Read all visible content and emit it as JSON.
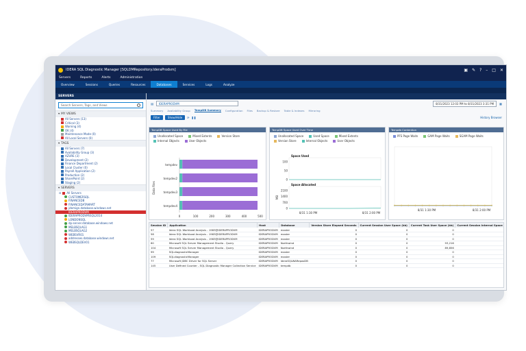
{
  "window": {
    "title": "IDERA SQL Diagnostic Manager [SQLDMRepository.IderaProdsm]"
  },
  "menu": [
    "Servers",
    "Reports",
    "Alerts",
    "Administration"
  ],
  "nav": [
    "Overview",
    "Sessions",
    "Queries",
    "Resources",
    "Databases",
    "Services",
    "Logs",
    "Analyze"
  ],
  "left": {
    "header": "SERVERS",
    "search_placeholder": "Search Servers, Tags, and Views",
    "my_views_label": "MY VIEWS",
    "views": [
      {
        "label": "All Servers (13)",
        "color": "#d32f2f"
      },
      {
        "label": "Critical (3)",
        "color": "#d32f2f"
      },
      {
        "label": "Warning (4)",
        "color": "#f2a900"
      },
      {
        "label": "OK (4)",
        "color": "#43a047"
      },
      {
        "label": "Maintenance Mode (0)",
        "color": "#9e9e9e"
      },
      {
        "label": "All Local Servers (0)",
        "color": "#d32f2f"
      }
    ],
    "tags_label": "TAGS",
    "tags": [
      {
        "label": "All Servers (7)"
      },
      {
        "label": "Availability Group (3)"
      },
      {
        "label": "AZURE (3)"
      },
      {
        "label": "Development (2)"
      },
      {
        "label": "Finance Department (2)"
      },
      {
        "label": "Local Cluster (0)"
      },
      {
        "label": "Payroll Application (2)"
      },
      {
        "label": "Production (2)"
      },
      {
        "label": "SharePoint (2)"
      },
      {
        "label": "Staging (2)"
      }
    ],
    "servers_label": "SERVERS",
    "servers_group": "All Servers",
    "servers": [
      {
        "label": "CUSTOMERSQL",
        "color": "#43a047"
      },
      {
        "label": "FINANCEDB",
        "color": "#f2a900"
      },
      {
        "label": "FINANCEDATAMART",
        "color": "#d32f2f"
      },
      {
        "label": "jdemign.database.windows.net",
        "color": "#d32f2f"
      },
      {
        "label": "IDERAPRODVM",
        "color": "#d32f2f",
        "selected": true
      },
      {
        "label": "IDERAPRODVM\\SQL2014",
        "color": "#43a047"
      },
      {
        "label": "LONDONSQL",
        "color": "#f2a900"
      },
      {
        "label": "dp-server.database.windows.net",
        "color": "#43a047"
      },
      {
        "label": "MELBSQLAG1",
        "color": "#43a047"
      },
      {
        "label": "MELBSQLAG2",
        "color": "#43a047"
      },
      {
        "label": "WEBSVR01",
        "color": "#d32f2f"
      },
      {
        "label": "addresses.database.windows.net",
        "color": "#d32f2f"
      },
      {
        "label": "WEBSQLDEV01",
        "color": "#d32f2f"
      }
    ]
  },
  "main": {
    "filter_value": "IDERAPRODVM",
    "date_range": "8/31/2023 12:03 PM to 8/31/2023 3:31 PM",
    "tabs": [
      "Summary",
      "Availability Group",
      "TempDB Summary",
      "Configuration",
      "Files",
      "Backup & Restore",
      "Table & Indexes",
      "Mirroring"
    ],
    "active_tab": "TempDB Summary",
    "filter_btn": "Filter",
    "show_hide": "Show/Hide",
    "history_link": "History Browser"
  },
  "chart1": {
    "header": "TempDB Space Used By File",
    "legend": [
      {
        "label": "Unallocated Space",
        "color": "#8fa8d6"
      },
      {
        "label": "Mixed Extents",
        "color": "#7cc576"
      },
      {
        "label": "Version Store",
        "color": "#e6b85c"
      },
      {
        "label": "Internal Objects",
        "color": "#54c2b5"
      },
      {
        "label": "User Objects",
        "color": "#9b6dd6"
      }
    ],
    "ylabel": "Data Files",
    "xlabel": "Megabytes",
    "xticks": [
      "0",
      "100",
      "200",
      "300",
      "400",
      "500"
    ]
  },
  "chart2": {
    "header": "TempDB Space Used Over Time",
    "legend": [
      {
        "label": "Unallocated Space",
        "color": "#8fa8d6"
      },
      {
        "label": "Used Space",
        "color": "#54c2b5"
      },
      {
        "label": "Mixed Extents",
        "color": "#7cc576"
      },
      {
        "label": "Version Store",
        "color": "#e6b85c"
      },
      {
        "label": "Internal Objects",
        "color": "#54c2b5"
      },
      {
        "label": "User Objects",
        "color": "#9b6dd6"
      }
    ],
    "sub1": "Space Used",
    "sub1_ticks": [
      "100",
      "50",
      "0"
    ],
    "sub2": "Space Allocated",
    "sub2_ticks": [
      "2100",
      "1400",
      "700",
      "0"
    ],
    "ylabel": "MB",
    "xticks": [
      "8/31 1:30 PM",
      "8/31 2:00 PM"
    ]
  },
  "chart3": {
    "header": "Tempdb Contention",
    "legend": [
      {
        "label": "PFS Page Waits",
        "color": "#7b8fd9"
      },
      {
        "label": "GAM Page Waits",
        "color": "#7cc576"
      },
      {
        "label": "SGAM Page Waits",
        "color": "#e6b85c"
      }
    ],
    "xticks": [
      "8/31 1:30 PM",
      "8/31 2:00 PM"
    ]
  },
  "chart_data": [
    {
      "type": "bar",
      "title": "TempDB Space Used By File",
      "categories": [
        "tempdev",
        "tempdev2",
        "tempdev3",
        "tempdev4"
      ],
      "series": [
        {
          "name": "Unallocated Space",
          "values": [
            0,
            0,
            0,
            0
          ]
        },
        {
          "name": "Internal Objects",
          "values": [
            18,
            18,
            18,
            18
          ]
        },
        {
          "name": "User Objects",
          "values": [
            465,
            465,
            465,
            465
          ]
        }
      ],
      "xlabel": "Megabytes",
      "ylabel": "Data Files",
      "xlim": [
        0,
        500
      ]
    },
    {
      "type": "line",
      "title": "TempDB Space Used Over Time",
      "series": [
        {
          "name": "Space Used",
          "values": [
            0,
            0,
            0,
            0
          ]
        },
        {
          "name": "Space Allocated",
          "values": [
            0,
            0,
            0,
            40
          ]
        }
      ]
    },
    {
      "type": "line",
      "title": "Tempdb Contention",
      "series": [
        {
          "name": "PFS Page Waits",
          "values": [
            0,
            0,
            0,
            0,
            0,
            0,
            0,
            0,
            0,
            0,
            0,
            0,
            0,
            0,
            0
          ]
        },
        {
          "name": "GAM Page Waits",
          "values": [
            0,
            0,
            0,
            0,
            0,
            0,
            0,
            0,
            0,
            0,
            0,
            0,
            0,
            0,
            0
          ]
        },
        {
          "name": "SGAM Page Waits",
          "values": [
            0,
            0,
            0,
            0,
            0,
            0,
            0,
            0,
            0,
            0,
            0,
            0,
            0,
            0,
            0
          ]
        }
      ]
    }
  ],
  "grid": {
    "columns": [
      "Session ID",
      "Application",
      "Host",
      "Database",
      "Version Store Elapsed Seconds",
      "Current Session User Space (kb)",
      "Current Task User Space (kb)",
      "Current Session Internal Space (kb)"
    ],
    "rows": [
      [
        "57",
        "Idera SQL Workload Analysis - 1983@IDERAPRODVM",
        "IDERAPRODVM",
        "master",
        "0",
        "0",
        "0",
        "64"
      ],
      [
        "58",
        "Idera SQL Workload Analysis - 1983@IDERAPRODVM",
        "IDERAPRODVM",
        "master",
        "0",
        "0",
        "0",
        "0"
      ],
      [
        "59",
        "Idera SQL Workload Analysis - 1983@IDERAPRODVM",
        "IDERAPRODVM",
        "master",
        "0",
        "0",
        "0",
        "0"
      ],
      [
        "60",
        "Microsoft SQL Server Management Studio - Query",
        "IDERAPRODVM",
        "Northwind",
        "0",
        "0",
        "93,216",
        "0"
      ],
      [
        "104",
        "Microsoft SQL Server Management Studio - Query",
        "IDERAPRODVM",
        "Northwind",
        "0",
        "0",
        "89,856",
        "0"
      ],
      [
        "99",
        "SQLdiagnosticManager",
        "IDERAPRODVM",
        "master",
        "0",
        "0",
        "0",
        "0"
      ],
      [
        "109",
        "SQLdiagnosticManager",
        "IDERAPRODVM",
        "master",
        "0",
        "0",
        "0",
        "0"
      ],
      [
        "77",
        "Microsoft JDBC Driver for SQL Server",
        "IDERAPRODVM",
        "IderaSQLWAReposDB",
        "0",
        "0",
        "0",
        "0"
      ],
      [
        "145",
        "User Defined Counter - SQL Diagnostic Manager Collection Service",
        "IDERAPRODVM",
        "tempdb",
        "0",
        "0",
        "0",
        "0"
      ]
    ]
  }
}
